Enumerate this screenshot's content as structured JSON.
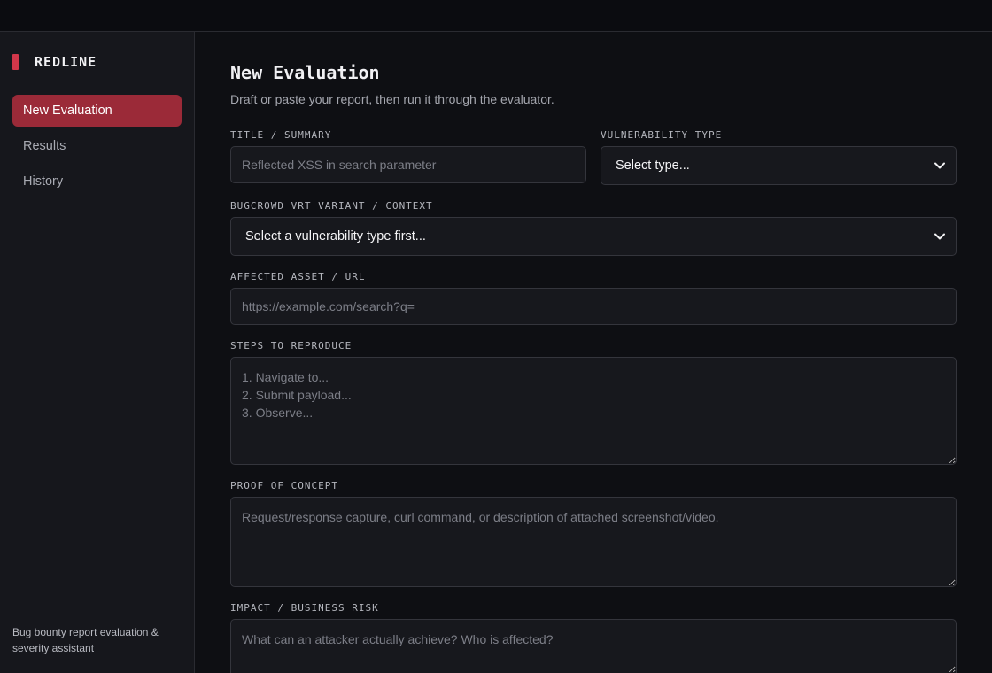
{
  "sidebar": {
    "brand": "REDLINE",
    "nav": [
      {
        "label": "New Evaluation",
        "active": true
      },
      {
        "label": "Results",
        "active": false
      },
      {
        "label": "History",
        "active": false
      }
    ],
    "footer": "Bug bounty report evaluation & severity assistant"
  },
  "main": {
    "title": "New Evaluation",
    "subtitle": "Draft or paste your report, then run it through the evaluator.",
    "fields": {
      "title": {
        "label": "TITLE / SUMMARY",
        "placeholder": "Reflected XSS in search parameter"
      },
      "vuln_type": {
        "label": "VULNERABILITY TYPE",
        "value": "Select type..."
      },
      "vrt": {
        "label": "BUGCROWD VRT VARIANT / CONTEXT",
        "value": "Select a vulnerability type first..."
      },
      "asset": {
        "label": "AFFECTED ASSET / URL",
        "placeholder": "https://example.com/search?q="
      },
      "steps": {
        "label": "STEPS TO REPRODUCE",
        "placeholder": "1. Navigate to...\n2. Submit payload...\n3. Observe..."
      },
      "poc": {
        "label": "PROOF OF CONCEPT",
        "placeholder": "Request/response capture, curl command, or description of attached screenshot/video."
      },
      "impact": {
        "label": "IMPACT / BUSINESS RISK",
        "placeholder": "What can an attacker actually achieve? Who is affected?"
      }
    }
  },
  "colors": {
    "accent": "#d2374a",
    "active_nav_bg": "#9b2a38",
    "background": "#0e0f13",
    "sidebar_bg": "#16171c",
    "field_bg": "#17181d"
  },
  "icons": {
    "select_arrow": "chevron-down-icon"
  }
}
